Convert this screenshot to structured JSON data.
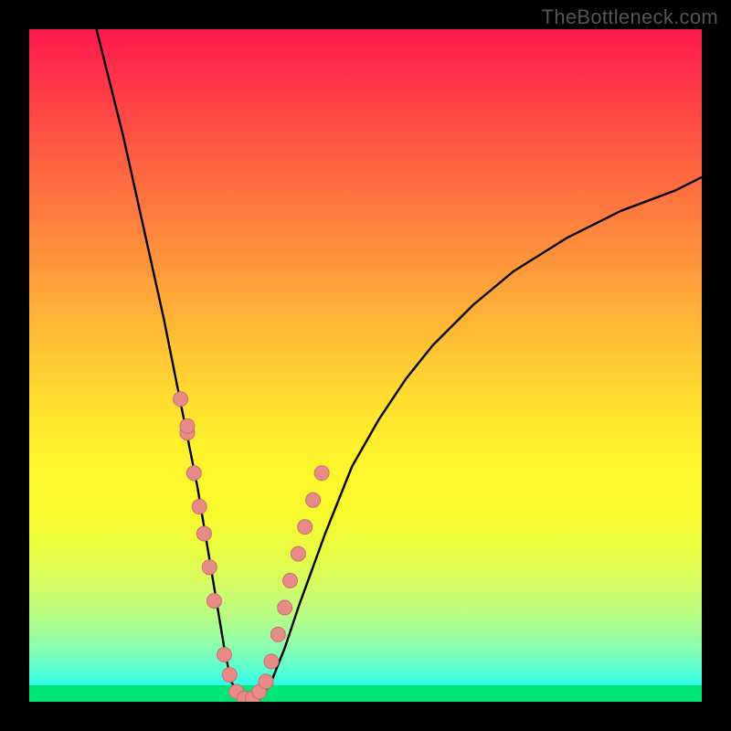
{
  "watermark": "TheBottleneck.com",
  "colors": {
    "curve": "#000000",
    "dot_fill": "#e88a88",
    "dot_stroke": "#c76f6d",
    "frame": "#000000"
  },
  "chart_data": {
    "type": "line",
    "title": "",
    "xlabel": "",
    "ylabel": "",
    "xlim": [
      0,
      100
    ],
    "ylim": [
      0,
      100
    ],
    "legend": false,
    "grid": false,
    "background": "rainbow-gradient-red-to-green",
    "series": [
      {
        "name": "bottleneck-curve",
        "x": [
          10,
          12,
          14,
          16,
          18,
          20,
          22,
          24,
          25,
          26,
          27,
          28,
          29,
          30,
          32,
          34,
          36,
          38,
          40,
          44,
          48,
          52,
          56,
          60,
          66,
          72,
          80,
          88,
          96,
          100
        ],
        "y": [
          100,
          92,
          84,
          75,
          66,
          57,
          47,
          37,
          32,
          26,
          20,
          14,
          8,
          3,
          0,
          0,
          3,
          8,
          14,
          25,
          35,
          42,
          48,
          53,
          59,
          64,
          69,
          73,
          76,
          78
        ]
      }
    ],
    "annotations": [
      {
        "type": "scatter-dots",
        "name": "marker-dots-on-curve",
        "points_xy": [
          [
            22.5,
            45
          ],
          [
            23.5,
            40
          ],
          [
            24.5,
            34
          ],
          [
            23.5,
            41
          ],
          [
            25.3,
            29
          ],
          [
            26.0,
            25
          ],
          [
            26.8,
            20
          ],
          [
            27.5,
            15
          ],
          [
            29.0,
            7
          ],
          [
            29.8,
            4
          ],
          [
            30.8,
            1.5
          ],
          [
            32.0,
            0.5
          ],
          [
            33.2,
            0.5
          ],
          [
            34.2,
            1.5
          ],
          [
            35.2,
            3
          ],
          [
            36.0,
            6
          ],
          [
            37.0,
            10
          ],
          [
            38.0,
            14
          ],
          [
            38.8,
            18
          ],
          [
            40.0,
            22
          ],
          [
            41.0,
            26
          ],
          [
            42.2,
            30
          ],
          [
            43.5,
            34
          ]
        ],
        "radius": 8,
        "color": "#e88a88"
      }
    ]
  }
}
